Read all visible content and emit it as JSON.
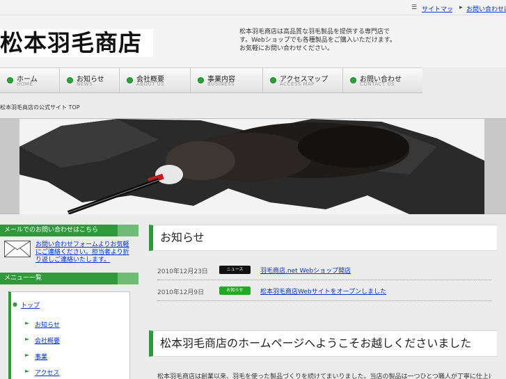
{
  "util": {
    "sitemap": "サイトマップ",
    "contact": "お問い合わせはこちら"
  },
  "header": {
    "logo": "松本羽毛商店",
    "tagline": "松本羽毛商店は高品質な羽毛製品を提供する専門店です。Webショップでも各種製品をご購入いただけます。お気軽にお問い合わせください。"
  },
  "nav": [
    {
      "jp": "ホーム",
      "en": "HOME"
    },
    {
      "jp": "お知らせ",
      "en": "NEWS"
    },
    {
      "jp": "会社概要",
      "en": "ABOUT US"
    },
    {
      "jp": "事業内容",
      "en": "BUSINESS"
    },
    {
      "jp": "アクセスマップ",
      "en": "ACCESS MAP"
    },
    {
      "jp": "お問い合わせ",
      "en": "CONTACT US"
    }
  ],
  "breadcrumb": "松本羽毛商店の公式サイト TOP",
  "sidebar": {
    "contact_head": "メールでのお問い合わせはこちら",
    "contact_link": "お問い合わせフォームよりお気軽にご連絡ください。担当者より折り返しご連絡いたします。",
    "menu_head": "メニュー一覧",
    "menu_top": "トップ",
    "menu_items": [
      "お知らせ",
      "会社概要",
      "事業",
      "アクセス"
    ]
  },
  "main": {
    "news_title": "お知らせ",
    "news": [
      {
        "date": "2010年12月23日",
        "badge": "ニュース",
        "title": "羽毛商店.net Webショップ開店"
      },
      {
        "date": "2010年12月9日",
        "badge": "お知らせ",
        "title": "松本羽毛商店Webサイトをオープンしました"
      }
    ],
    "about_title": "松本羽毛商店のホームページへようこそお越しくださいました",
    "about_text": "松本羽毛商店は創業以来、羽毛を使った製品づくりを続けてまいりました。当店の製品は一つひとつ職人が丁寧に仕上げております。"
  },
  "colors": {
    "accent": "#2f9a3a",
    "link": "#0033cc",
    "badge_news": "#111111",
    "badge_info": "#22aa22"
  }
}
